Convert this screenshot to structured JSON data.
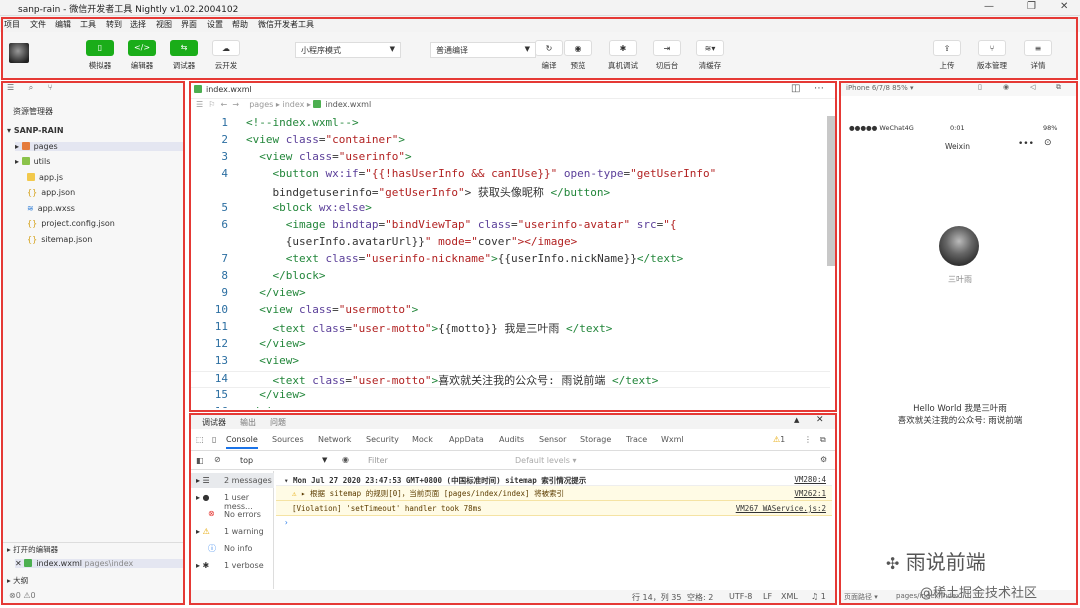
{
  "window": {
    "title": "sanp-rain - 微信开发者工具 Nightly v1.02.2004102"
  },
  "menu": [
    "项目",
    "文件",
    "编辑",
    "工具",
    "转到",
    "选择",
    "视图",
    "界面",
    "设置",
    "帮助",
    "微信开发者工具"
  ],
  "toolbar": {
    "buttons": [
      {
        "label": "模拟器"
      },
      {
        "label": "编辑器"
      },
      {
        "label": "调试器"
      },
      {
        "label": "云开发"
      }
    ],
    "mode_select": "小程序模式",
    "compile_select": "普通编译",
    "actions": [
      {
        "label": "编译"
      },
      {
        "label": "预览"
      },
      {
        "label": "真机调试"
      },
      {
        "label": "切后台"
      },
      {
        "label": "清缓存"
      }
    ],
    "right": [
      {
        "label": "上传"
      },
      {
        "label": "版本管理"
      },
      {
        "label": "详情"
      }
    ]
  },
  "explorer": {
    "title": "资源管理器",
    "project": "SANP-RAIN",
    "files": [
      {
        "name": "pages",
        "type": "folder"
      },
      {
        "name": "utils",
        "type": "folder"
      },
      {
        "name": "app.js"
      },
      {
        "name": "app.json"
      },
      {
        "name": "app.wxss"
      },
      {
        "name": "project.config.json"
      },
      {
        "name": "sitemap.json"
      }
    ],
    "open_editors": "打开的编辑器",
    "open_file": "index.wxml",
    "open_file_path": "pages\\index",
    "outline": "大纲",
    "errors": "0",
    "warnings": "0"
  },
  "editor": {
    "tab": "index.wxml",
    "breadcrumb": [
      "pages",
      "index",
      "index.wxml"
    ],
    "lines": [
      {
        "n": "1",
        "c": "<!--index.wxml-->"
      },
      {
        "n": "2",
        "c": "<view class=\"container\">"
      },
      {
        "n": "3",
        "c": "  <view class=\"userinfo\">"
      },
      {
        "n": "4",
        "c": "    <button wx:if=\"{{!hasUserInfo && canIUse}}\" open-type=\"getUserInfo\""
      },
      {
        "n": "",
        "c": "    bindgetuserinfo=\"getUserInfo\"> 获取头像昵称 </button>"
      },
      {
        "n": "5",
        "c": "    <block wx:else>"
      },
      {
        "n": "6",
        "c": "      <image bindtap=\"bindViewTap\" class=\"userinfo-avatar\" src=\"{"
      },
      {
        "n": "",
        "c": "      {userInfo.avatarUrl}}\" mode=\"cover\"></image>"
      },
      {
        "n": "7",
        "c": "      <text class=\"userinfo-nickname\">{{userInfo.nickName}}</text>"
      },
      {
        "n": "8",
        "c": "    </block>"
      },
      {
        "n": "9",
        "c": "  </view>"
      },
      {
        "n": "10",
        "c": "  <view class=\"usermotto\">"
      },
      {
        "n": "11",
        "c": "    <text class=\"user-motto\">{{motto}} 我是三叶雨 </text>"
      },
      {
        "n": "12",
        "c": "  </view>"
      },
      {
        "n": "13",
        "c": "  <view>"
      },
      {
        "n": "14",
        "c": "    <text class=\"user-motto\">喜欢就关注我的公众号: 雨说前端 </text>"
      },
      {
        "n": "15",
        "c": "  </view>"
      },
      {
        "n": "16",
        "c": "</view>"
      }
    ]
  },
  "console": {
    "panel_tabs": [
      "调试器",
      "输出",
      "问题"
    ],
    "tabs": [
      "Console",
      "Sources",
      "Network",
      "Security",
      "Mock",
      "AppData",
      "Audits",
      "Sensor",
      "Storage",
      "Trace",
      "Wxml"
    ],
    "warn_count": "1",
    "context": "top",
    "filter_placeholder": "Filter",
    "levels": "Default levels",
    "sidebar": [
      {
        "label": "2 messages"
      },
      {
        "label": "1 user mess..."
      },
      {
        "label": "No errors"
      },
      {
        "label": "1 warning"
      },
      {
        "label": "No info"
      },
      {
        "label": "1 verbose"
      }
    ],
    "logs": [
      {
        "text": "Mon Jul 27 2020 23:47:53 GMT+0800 (中国标准时间) sitemap 索引情况提示",
        "src": "VM280:4",
        "kind": "info"
      },
      {
        "text": "▸ 根据 sitemap 的规则[0]，当前页面 [pages/index/index] 将被索引",
        "src": "VM262:1",
        "kind": "warn"
      },
      {
        "text": "[Violation] 'setTimeout' handler took 78ms",
        "src": "VM267 WAService.js:2",
        "kind": "violation"
      }
    ]
  },
  "status": {
    "pos": "行 14，列 35",
    "spaces": "空格: 2",
    "enc": "UTF-8",
    "eol": "LF",
    "lang": "XML",
    "bell": "1"
  },
  "simulator": {
    "device": "iPhone 6/7/8 85% ▾",
    "carrier": "●●●●● WeChat4G",
    "time": "0:01",
    "battery": "98%",
    "nav_title": "Weixin",
    "nickname": "三叶雨",
    "motto1": "Hello World 我是三叶雨",
    "motto2": "喜欢就关注我的公众号: 雨说前端",
    "footer_path": "页面路径 ▾",
    "footer_page": "pages/index/index"
  },
  "watermark": {
    "brand": "雨说前端",
    "site": "@稀土掘金技术社区"
  }
}
